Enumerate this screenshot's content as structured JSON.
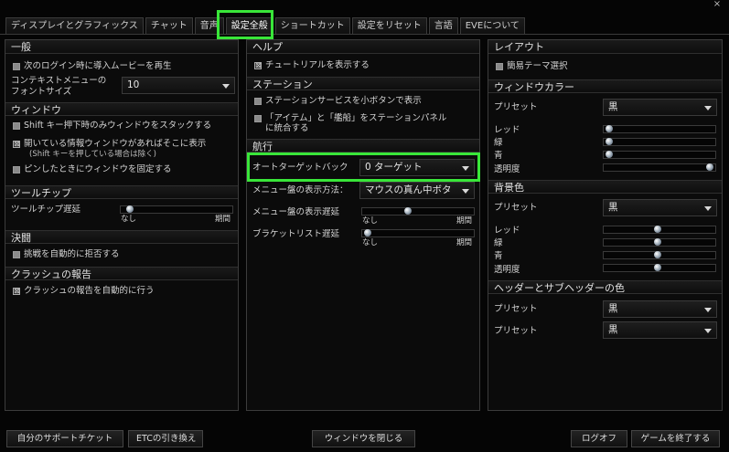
{
  "window": {
    "close_glyph": "×"
  },
  "tabs": [
    {
      "label": "ディスプレイとグラフィックス"
    },
    {
      "label": "チャット"
    },
    {
      "label": "音声"
    },
    {
      "label": "設定全般"
    },
    {
      "label": "ショートカット"
    },
    {
      "label": "設定をリセット"
    },
    {
      "label": "言語"
    },
    {
      "label": "EVEについて"
    }
  ],
  "active_tab": "設定全般",
  "left": {
    "general": {
      "title": "一般",
      "intro_movie": "次のログイン時に導入ムービーを再生",
      "context_font_label_1": "コンテキストメニューの",
      "context_font_label_2": "フォントサイズ",
      "context_font_value": "10"
    },
    "window": {
      "title": "ウィンドウ",
      "shift_stack": "Shift キー押下時のみウィンドウをスタックする",
      "open_info_1": "開いている情報ウィンドウがあればそこに表示",
      "open_info_2": "(Shift キーを押している場合は除く)",
      "lock_pin": "ピンしたときにウィンドウを固定する"
    },
    "tooltip": {
      "title": "ツールチップ",
      "delay_label": "ツールチップ遅延",
      "delay_level": 0.05,
      "tick_min": "なし",
      "tick_max": "期間"
    },
    "duel": {
      "title": "決闘",
      "auto_reject": "挑戦を自動的に拒否する"
    },
    "crash": {
      "title": "クラッシュの報告",
      "auto_report": "クラッシュの報告を自動的に行う"
    }
  },
  "middle": {
    "help": {
      "title": "ヘルプ",
      "show_tutorial": "チュートリアルを表示する"
    },
    "station": {
      "title": "ステーション",
      "small_buttons": "ステーションサービスを小ボタンで表示",
      "integrate_1": "「アイテム」と「艦船」をステーションパネル",
      "integrate_2": "に統合する"
    },
    "nav": {
      "title": "航行",
      "auto_target_label": "オートターゲットバック",
      "auto_target_value": "0 ターゲット",
      "menu_method_label": "メニュー盤の表示方法：",
      "menu_method_value": "マウスの真ん中ボタ",
      "menu_delay_label": "メニュー盤の表示遅延",
      "menu_delay_level": 0.4,
      "bracket_delay_label": "ブラケットリスト遅延",
      "bracket_delay_level": 0.02,
      "tick_min": "なし",
      "tick_max": "期間"
    }
  },
  "right": {
    "layout": {
      "title": "レイアウト",
      "simple_theme": "簡易テーマ選択"
    },
    "window_color": {
      "title": "ウィンドウカラー",
      "preset_label": "プリセット",
      "preset_value": "黒",
      "red_label": "レッド",
      "green_label": "緑",
      "blue_label": "青",
      "alpha_label": "透明度",
      "red_level": 0.02,
      "green_level": 0.02,
      "blue_level": 0.02,
      "alpha_level": 0.98
    },
    "bg_color": {
      "title": "背景色",
      "preset_label": "プリセット",
      "preset_value": "黒",
      "red_label": "レッド",
      "green_label": "緑",
      "blue_label": "青",
      "alpha_label": "透明度",
      "red_level": 0.48,
      "green_level": 0.48,
      "blue_level": 0.48,
      "alpha_level": 0.48
    },
    "header_color": {
      "title": "ヘッダーとサブヘッダーの色",
      "preset1_label": "プリセット",
      "preset1_value": "黒",
      "preset2_label": "プリセット",
      "preset2_value": "黒"
    }
  },
  "footer": {
    "support_ticket": "自分のサポートチケット",
    "etc_redeem": "ETCの引き換え",
    "close_window": "ウィンドウを閉じる",
    "logoff": "ログオフ",
    "quit_game": "ゲームを終了する"
  },
  "colors": {
    "highlight": "#39e639",
    "panel_bg": "#0b0b0b",
    "page_bg": "#050505"
  }
}
